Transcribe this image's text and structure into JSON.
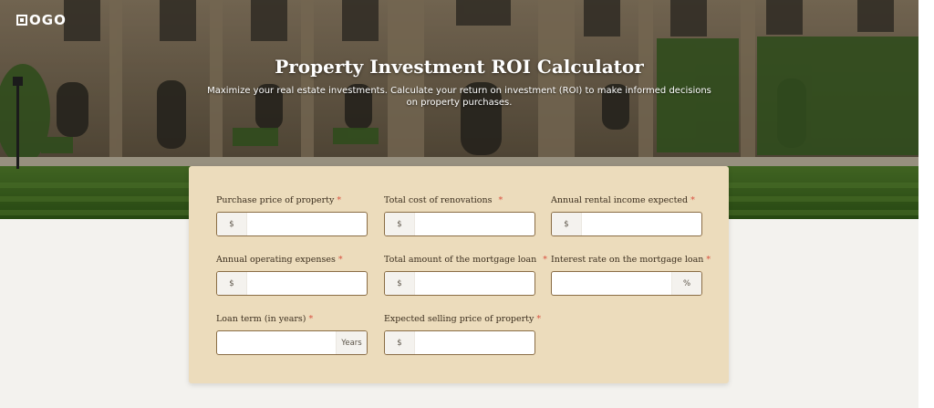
{
  "brand": {
    "logo_text": "OGO"
  },
  "hero": {
    "title": "Property Investment ROI Calculator",
    "subtitle": "Maximize your real estate investments. Calculate your return on investment (ROI) to make informed decisions on property purchases."
  },
  "form": {
    "required_marker": "*",
    "fields": [
      {
        "label": "Purchase price of property",
        "prefix": "$",
        "suffix": "",
        "value": ""
      },
      {
        "label": "Total cost of renovations",
        "prefix": "$",
        "suffix": "",
        "value": ""
      },
      {
        "label": "Annual rental income expected",
        "prefix": "$",
        "suffix": "",
        "value": ""
      },
      {
        "label": "Annual operating expenses",
        "prefix": "$",
        "suffix": "",
        "value": ""
      },
      {
        "label": "Total amount of the mortgage loan",
        "prefix": "$",
        "suffix": "",
        "value": ""
      },
      {
        "label": "Interest rate on the mortgage loan",
        "prefix": "",
        "suffix": "%",
        "value": ""
      },
      {
        "label": "Loan term (in years)",
        "prefix": "",
        "suffix": "Years",
        "value": ""
      },
      {
        "label": "Expected selling price of property",
        "prefix": "$",
        "suffix": "",
        "value": ""
      }
    ]
  }
}
